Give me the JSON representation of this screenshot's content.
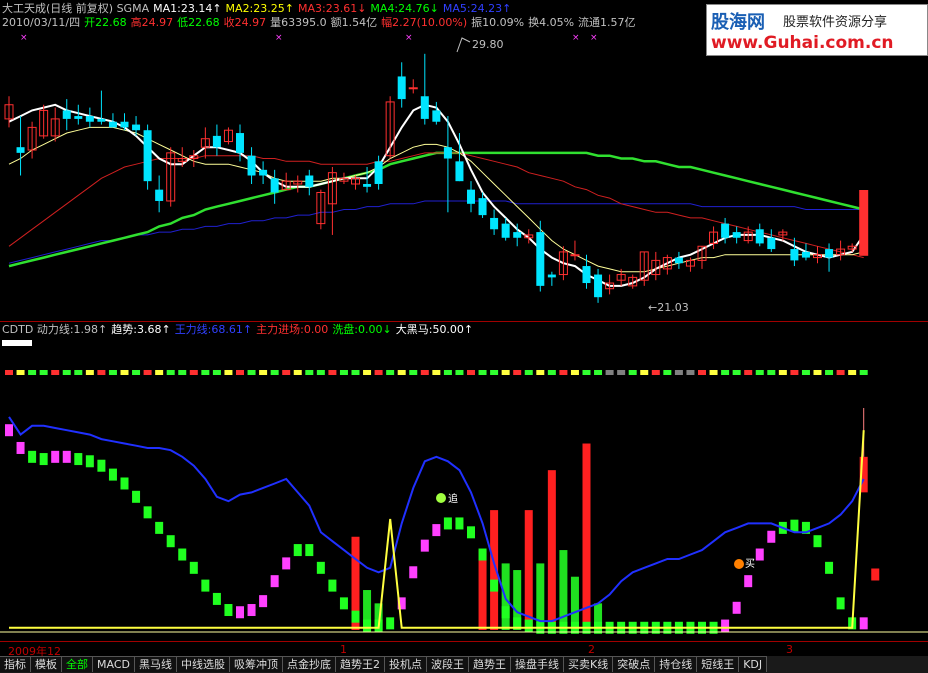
{
  "info_line1": [
    {
      "text": "大工天成(日线 前复权) SGMA",
      "color": "#c0c0c0"
    },
    {
      "text": "MA1:23.14↑",
      "color": "#ffffff"
    },
    {
      "text": "MA2:23.25↑",
      "color": "#ffff00"
    },
    {
      "text": "MA3:23.61↓",
      "color": "#ff3030"
    },
    {
      "text": "MA4:24.76↓",
      "color": "#00ff00"
    },
    {
      "text": "MA5:24.23↑",
      "color": "#3040ff"
    }
  ],
  "info_line2": [
    {
      "text": "2010/03/11/四",
      "color": "#c0c0c0"
    },
    {
      "text": "开22.68",
      "color": "#00ff00"
    },
    {
      "text": "高24.97",
      "color": "#ff3030"
    },
    {
      "text": "低22.68",
      "color": "#00ff00"
    },
    {
      "text": "收24.97",
      "color": "#ff3030"
    },
    {
      "text": "量63395.0",
      "color": "#c0c0c0"
    },
    {
      "text": "额1.54亿",
      "color": "#c0c0c0"
    },
    {
      "text": "幅2.27(10.00%)",
      "color": "#ff3030"
    },
    {
      "text": "振10.09%",
      "color": "#c0c0c0"
    },
    {
      "text": "换4.05%",
      "color": "#c0c0c0"
    },
    {
      "text": "流通1.57亿",
      "color": "#c0c0c0"
    }
  ],
  "logo": {
    "line1": "股海网",
    "line1b": "股票软件资源分享",
    "line2": "www.Guhai.com.cn"
  },
  "price_annotations": {
    "high": "29.80",
    "low": "←21.03"
  },
  "indicator_header": [
    {
      "text": "CDTD 动力线:1.98↑",
      "color": "#c0c0c0"
    },
    {
      "text": "趋势:3.68↑",
      "color": "#ffffff"
    },
    {
      "text": "王力线:68.61↑",
      "color": "#3040ff"
    },
    {
      "text": "主力进场:0.00",
      "color": "#ff3030"
    },
    {
      "text": "洗盘:0.00↓",
      "color": "#00ff00"
    },
    {
      "text": "大黑马:50.00↑",
      "color": "#ffffff"
    }
  ],
  "signals": {
    "zhui": "追",
    "mai": "买"
  },
  "axis_labels": [
    {
      "text": "2009年12",
      "left": 8
    },
    {
      "text": "1",
      "left": 340
    },
    {
      "text": "2",
      "left": 588
    },
    {
      "text": "3",
      "left": 786
    }
  ],
  "tabs": [
    {
      "label": "指标",
      "state": ""
    },
    {
      "label": "模板",
      "state": ""
    },
    {
      "label": "全部",
      "state": "active"
    },
    {
      "label": "MACD",
      "state": ""
    },
    {
      "label": "黑马线",
      "state": ""
    },
    {
      "label": "中线选股",
      "state": ""
    },
    {
      "label": "吸筹冲顶",
      "state": ""
    },
    {
      "label": "点金抄底",
      "state": ""
    },
    {
      "label": "趋势王2",
      "state": ""
    },
    {
      "label": "投机点",
      "state": ""
    },
    {
      "label": "波段王",
      "state": ""
    },
    {
      "label": "趋势王",
      "state": ""
    },
    {
      "label": "操盘手线",
      "state": ""
    },
    {
      "label": "买卖K线",
      "state": ""
    },
    {
      "label": "突破点",
      "state": ""
    },
    {
      "label": "持仓线",
      "state": ""
    },
    {
      "label": "短线王",
      "state": ""
    },
    {
      "label": "KDJ",
      "state": ""
    }
  ],
  "colors": {
    "up": "#ff3030",
    "down": "#00e5ff",
    "ma1": "#ffffff",
    "ma2": "#ffff99",
    "ma3": "#d02020",
    "ma4": "#30e030",
    "ma5": "#2020d0"
  },
  "chart_data": [
    {
      "type": "candlestick",
      "title": "大工天成(日线 前复权)",
      "ylim": [
        20.5,
        30.5
      ],
      "candles": [
        [
          27.5,
          28.3,
          27.2,
          28.0
        ],
        [
          26.5,
          27.6,
          25.5,
          26.3
        ],
        [
          26.4,
          27.4,
          26.1,
          27.2
        ],
        [
          26.9,
          28.0,
          26.8,
          27.8
        ],
        [
          26.9,
          27.9,
          26.7,
          27.5
        ],
        [
          27.8,
          28.2,
          27.1,
          27.5
        ],
        [
          27.6,
          28.0,
          27.3,
          27.5
        ],
        [
          27.6,
          27.9,
          27.2,
          27.4
        ],
        [
          27.5,
          28.5,
          27.3,
          27.4
        ],
        [
          27.4,
          27.7,
          27.2,
          27.2
        ],
        [
          27.4,
          27.7,
          27.1,
          27.2
        ],
        [
          27.3,
          27.6,
          26.9,
          27.1
        ],
        [
          27.1,
          27.3,
          25.0,
          25.3
        ],
        [
          25.0,
          25.5,
          24.2,
          24.6
        ],
        [
          24.6,
          26.5,
          24.4,
          26.3
        ],
        [
          26.0,
          26.5,
          25.8,
          26.1
        ],
        [
          26.1,
          26.4,
          25.8,
          26.2
        ],
        [
          26.5,
          27.2,
          26.1,
          26.8
        ],
        [
          26.9,
          27.3,
          26.2,
          26.5
        ],
        [
          26.7,
          27.2,
          26.6,
          27.1
        ],
        [
          27.0,
          27.3,
          26.0,
          26.3
        ],
        [
          26.2,
          26.5,
          25.2,
          25.5
        ],
        [
          25.7,
          26.0,
          25.2,
          25.5
        ],
        [
          25.4,
          25.7,
          24.5,
          24.9
        ],
        [
          25.0,
          25.6,
          25.0,
          25.3
        ],
        [
          25.2,
          25.5,
          24.9,
          25.3
        ],
        [
          25.5,
          25.7,
          24.8,
          25.1
        ],
        [
          23.8,
          25.0,
          23.6,
          24.9
        ],
        [
          24.5,
          25.8,
          23.4,
          25.6
        ],
        [
          25.3,
          25.6,
          25.2,
          25.4
        ],
        [
          25.2,
          25.5,
          25.0,
          25.4
        ],
        [
          25.2,
          25.8,
          24.9,
          25.1
        ],
        [
          26.0,
          26.2,
          25.0,
          25.2
        ],
        [
          26.2,
          28.3,
          26.1,
          28.1
        ],
        [
          29.0,
          29.5,
          27.9,
          28.2
        ],
        [
          28.6,
          28.9,
          28.4,
          28.6
        ],
        [
          28.3,
          29.8,
          27.3,
          27.5
        ],
        [
          27.8,
          28.1,
          27.3,
          27.4
        ],
        [
          26.5,
          27.6,
          24.2,
          26.1
        ],
        [
          26.0,
          27.0,
          25.3,
          25.3
        ],
        [
          25.0,
          25.3,
          24.2,
          24.5
        ],
        [
          24.7,
          24.9,
          24.0,
          24.1
        ],
        [
          24.0,
          24.3,
          23.4,
          23.6
        ],
        [
          23.8,
          24.0,
          23.2,
          23.3
        ],
        [
          23.5,
          23.8,
          23.0,
          23.3
        ],
        [
          23.3,
          23.6,
          23.1,
          23.4
        ],
        [
          23.5,
          23.9,
          21.4,
          21.6
        ],
        [
          22.0,
          22.1,
          21.6,
          21.9
        ],
        [
          22.0,
          23.0,
          21.8,
          22.8
        ],
        [
          22.7,
          23.2,
          22.5,
          22.7
        ],
        [
          22.3,
          22.7,
          21.5,
          21.7
        ],
        [
          22.0,
          22.2,
          21.0,
          21.2
        ],
        [
          21.5,
          22.0,
          21.3,
          21.7
        ],
        [
          21.8,
          22.2,
          21.6,
          22.0
        ],
        [
          21.6,
          22.0,
          21.5,
          21.9
        ],
        [
          21.8,
          22.8,
          21.6,
          22.8
        ],
        [
          22.0,
          22.8,
          21.8,
          22.5
        ],
        [
          22.2,
          22.7,
          22.0,
          22.6
        ],
        [
          22.6,
          22.8,
          22.2,
          22.4
        ],
        [
          22.3,
          22.6,
          22.1,
          22.5
        ],
        [
          22.5,
          23.0,
          22.2,
          23.0
        ],
        [
          23.1,
          23.7,
          22.9,
          23.5
        ],
        [
          23.8,
          24.0,
          23.1,
          23.3
        ],
        [
          23.5,
          23.7,
          23.1,
          23.3
        ],
        [
          23.2,
          23.7,
          23.1,
          23.5
        ],
        [
          23.6,
          23.8,
          23.0,
          23.1
        ],
        [
          23.3,
          23.6,
          22.8,
          22.9
        ],
        [
          23.4,
          23.6,
          23.2,
          23.5
        ],
        [
          22.9,
          23.3,
          22.3,
          22.5
        ],
        [
          22.8,
          23.1,
          22.5,
          22.6
        ],
        [
          22.6,
          23.0,
          22.4,
          22.7
        ],
        [
          22.9,
          23.1,
          22.1,
          22.6
        ],
        [
          22.7,
          23.2,
          22.5,
          22.9
        ],
        [
          22.9,
          23.1,
          22.8,
          23.0
        ],
        [
          22.68,
          24.97,
          22.68,
          24.97
        ]
      ],
      "ma1": [
        27.4,
        27.6,
        27.8,
        27.9,
        28.0,
        27.8,
        27.7,
        27.6,
        27.5,
        27.4,
        27.2,
        26.9,
        26.5,
        26.1,
        25.9,
        25.9,
        26.2,
        26.5,
        26.5,
        26.4,
        26.3,
        26.0,
        25.6,
        25.3,
        25.1,
        25.1,
        25.1,
        25.2,
        25.3,
        25.4,
        25.4,
        25.4,
        25.8,
        26.5,
        27.2,
        27.8,
        28.0,
        27.9,
        27.4,
        26.6,
        25.7,
        24.9,
        24.4,
        24.0,
        23.6,
        23.3,
        22.9,
        22.6,
        22.4,
        22.3,
        22.0,
        21.8,
        21.6,
        21.6,
        21.7,
        21.9,
        22.2,
        22.4,
        22.6,
        22.7,
        22.9,
        23.1,
        23.3,
        23.4,
        23.4,
        23.4,
        23.3,
        23.2,
        23.0,
        22.8,
        22.7,
        22.6,
        22.7,
        22.8,
        23.4
      ],
      "ma2": [
        25.9,
        26.1,
        26.4,
        26.6,
        26.8,
        27.0,
        27.1,
        27.2,
        27.2,
        27.2,
        27.1,
        27.0,
        26.8,
        26.6,
        26.4,
        26.2,
        26.0,
        25.9,
        25.9,
        25.9,
        25.8,
        25.7,
        25.6,
        25.4,
        25.3,
        25.3,
        25.3,
        25.3,
        25.4,
        25.4,
        25.5,
        25.6,
        25.8,
        26.1,
        26.3,
        26.5,
        26.6,
        26.6,
        26.5,
        26.3,
        26.0,
        25.6,
        25.2,
        24.8,
        24.4,
        24.0,
        23.6,
        23.2,
        22.9,
        22.7,
        22.5,
        22.3,
        22.2,
        22.1,
        22.1,
        22.1,
        22.2,
        22.3,
        22.4,
        22.5,
        22.6,
        22.6,
        22.7,
        22.7,
        22.7,
        22.7,
        22.7,
        22.7,
        22.7,
        22.7,
        22.7,
        22.7,
        22.7,
        22.7,
        22.8
      ],
      "ma3": [
        23.0,
        23.3,
        23.6,
        23.9,
        24.2,
        24.5,
        24.8,
        25.1,
        25.4,
        25.6,
        25.8,
        25.9,
        26.0,
        26.1,
        26.1,
        26.1,
        26.1,
        26.2,
        26.2,
        26.2,
        26.2,
        26.2,
        26.1,
        26.1,
        26.0,
        26.0,
        26.0,
        25.9,
        25.9,
        25.9,
        25.9,
        25.9,
        26.0,
        26.0,
        26.1,
        26.2,
        26.3,
        26.3,
        26.3,
        26.3,
        26.2,
        26.1,
        26.0,
        25.9,
        25.8,
        25.6,
        25.5,
        25.4,
        25.3,
        25.1,
        25.0,
        24.8,
        24.7,
        24.5,
        24.4,
        24.3,
        24.2,
        24.2,
        24.1,
        24.0,
        24.0,
        23.9,
        23.8,
        23.7,
        23.6,
        23.5,
        23.4,
        23.3,
        23.2,
        23.1,
        23.0,
        22.9,
        22.8,
        22.7,
        22.6
      ],
      "ma4": [
        22.3,
        22.4,
        22.5,
        22.6,
        22.7,
        22.8,
        22.9,
        23.0,
        23.1,
        23.2,
        23.3,
        23.4,
        23.5,
        23.7,
        23.8,
        24.0,
        24.1,
        24.3,
        24.4,
        24.5,
        24.6,
        24.7,
        24.8,
        24.9,
        25.0,
        25.1,
        25.1,
        25.2,
        25.3,
        25.4,
        25.5,
        25.6,
        25.7,
        25.9,
        26.0,
        26.1,
        26.2,
        26.3,
        26.3,
        26.3,
        26.3,
        26.3,
        26.3,
        26.3,
        26.3,
        26.3,
        26.3,
        26.3,
        26.3,
        26.3,
        26.3,
        26.2,
        26.2,
        26.1,
        26.1,
        26.0,
        26.0,
        25.9,
        25.8,
        25.8,
        25.7,
        25.6,
        25.5,
        25.4,
        25.3,
        25.2,
        25.1,
        25.0,
        24.9,
        24.8,
        24.7,
        24.6,
        24.5,
        24.4,
        24.3
      ],
      "ma5": [
        22.4,
        22.5,
        22.6,
        22.7,
        22.8,
        22.9,
        23.0,
        23.1,
        23.2,
        23.2,
        23.3,
        23.4,
        23.4,
        23.5,
        23.5,
        23.6,
        23.6,
        23.7,
        23.7,
        23.8,
        23.8,
        23.9,
        23.9,
        24.0,
        24.0,
        24.1,
        24.1,
        24.2,
        24.2,
        24.3,
        24.3,
        24.4,
        24.4,
        24.5,
        24.5,
        24.5,
        24.6,
        24.6,
        24.6,
        24.6,
        24.6,
        24.6,
        24.6,
        24.6,
        24.5,
        24.5,
        24.5,
        24.5,
        24.5,
        24.5,
        24.5,
        24.5,
        24.5,
        24.5,
        24.5,
        24.5,
        24.5,
        24.5,
        24.5,
        24.5,
        24.4,
        24.4,
        24.4,
        24.4,
        24.4,
        24.4,
        24.4,
        24.4,
        24.4,
        24.3,
        24.3,
        24.3,
        24.3,
        24.3,
        24.3
      ]
    },
    {
      "type": "bar",
      "title": "CDTD",
      "ylim": [
        0,
        100
      ],
      "trend": [
        90,
        82,
        78,
        77,
        78,
        78,
        77,
        76,
        74,
        70,
        66,
        60,
        53,
        46,
        40,
        34,
        28,
        20,
        14,
        9,
        8,
        9,
        13,
        22,
        30,
        36,
        36,
        28,
        20,
        12,
        6,
        2,
        2,
        3,
        12,
        26,
        38,
        45,
        48,
        48,
        44,
        34,
        20,
        8,
        3,
        2,
        1,
        1,
        1,
        1,
        1,
        1,
        1,
        1,
        1,
        1,
        1,
        1,
        1,
        1,
        1,
        1,
        2,
        10,
        22,
        34,
        42,
        46,
        47,
        46,
        40,
        28,
        12,
        3,
        3,
        25
      ],
      "trend_color": [
        "m",
        "m",
        "g",
        "g",
        "m",
        "m",
        "g",
        "g",
        "g",
        "g",
        "g",
        "g",
        "g",
        "g",
        "g",
        "g",
        "g",
        "g",
        "g",
        "g",
        "m",
        "m",
        "m",
        "m",
        "m",
        "g",
        "g",
        "g",
        "g",
        "g",
        "g",
        "g",
        "g",
        "g",
        "m",
        "m",
        "m",
        "m",
        "g",
        "g",
        "g",
        "g",
        "g",
        "g",
        "g",
        "g",
        "g",
        "g",
        "g",
        "g",
        "g",
        "g",
        "g",
        "g",
        "g",
        "g",
        "g",
        "g",
        "g",
        "g",
        "g",
        "g",
        "m",
        "m",
        "m",
        "m",
        "m",
        "g",
        "g",
        "g",
        "g",
        "g",
        "g",
        "g",
        "m",
        "r"
      ],
      "power": [
        96,
        88,
        92,
        92,
        91,
        90,
        89,
        88,
        86,
        85,
        84,
        83,
        82,
        82,
        81,
        78,
        74,
        68,
        60,
        58,
        61,
        62,
        64,
        66,
        68,
        62,
        56,
        44,
        40,
        36,
        32,
        28,
        26,
        28,
        48,
        64,
        76,
        78,
        76,
        72,
        62,
        48,
        30,
        14,
        8,
        6,
        4,
        4,
        6,
        8,
        10,
        12,
        16,
        22,
        26,
        28,
        30,
        32,
        32,
        34,
        36,
        40,
        44,
        46,
        48,
        48,
        48,
        46,
        44,
        44,
        46,
        48,
        52,
        58,
        68
      ],
      "buy_bars": [
        {
          "i": 30,
          "v": 14,
          "c": "r"
        },
        {
          "i": 31,
          "v": 6,
          "c": "g"
        },
        {
          "i": 32,
          "v": 4,
          "c": "g"
        },
        {
          "i": 41,
          "v": 12,
          "c": "r"
        },
        {
          "i": 42,
          "v": 18,
          "c": "r"
        },
        {
          "i": 43,
          "v": 10,
          "c": "g"
        },
        {
          "i": 44,
          "v": 9,
          "c": "g"
        },
        {
          "i": 45,
          "v": 18,
          "c": "r"
        },
        {
          "i": 46,
          "v": 10,
          "c": "g"
        },
        {
          "i": 47,
          "v": 24,
          "c": "r"
        },
        {
          "i": 48,
          "v": 12,
          "c": "g"
        },
        {
          "i": 49,
          "v": 8,
          "c": "g"
        },
        {
          "i": 50,
          "v": 28,
          "c": "r"
        },
        {
          "i": 51,
          "v": 4,
          "c": "g"
        }
      ],
      "spikes": [
        {
          "i": 33,
          "v": 50
        },
        {
          "i": 74,
          "v": 90
        }
      ]
    }
  ]
}
